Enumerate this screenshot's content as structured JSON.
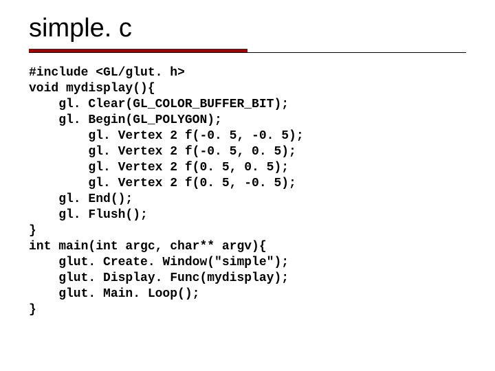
{
  "title": "simple. c",
  "code_lines": [
    "#include <GL/glut. h>",
    "void mydisplay(){",
    "    gl. Clear(GL_COLOR_BUFFER_BIT);",
    "    gl. Begin(GL_POLYGON);",
    "        gl. Vertex 2 f(-0. 5, -0. 5);",
    "        gl. Vertex 2 f(-0. 5, 0. 5);",
    "        gl. Vertex 2 f(0. 5, 0. 5);",
    "        gl. Vertex 2 f(0. 5, -0. 5);",
    "    gl. End();",
    "    gl. Flush();",
    "}",
    "int main(int argc, char** argv){",
    "    glut. Create. Window(\"simple\");",
    "    glut. Display. Func(mydisplay);",
    "    glut. Main. Loop();",
    "}"
  ]
}
